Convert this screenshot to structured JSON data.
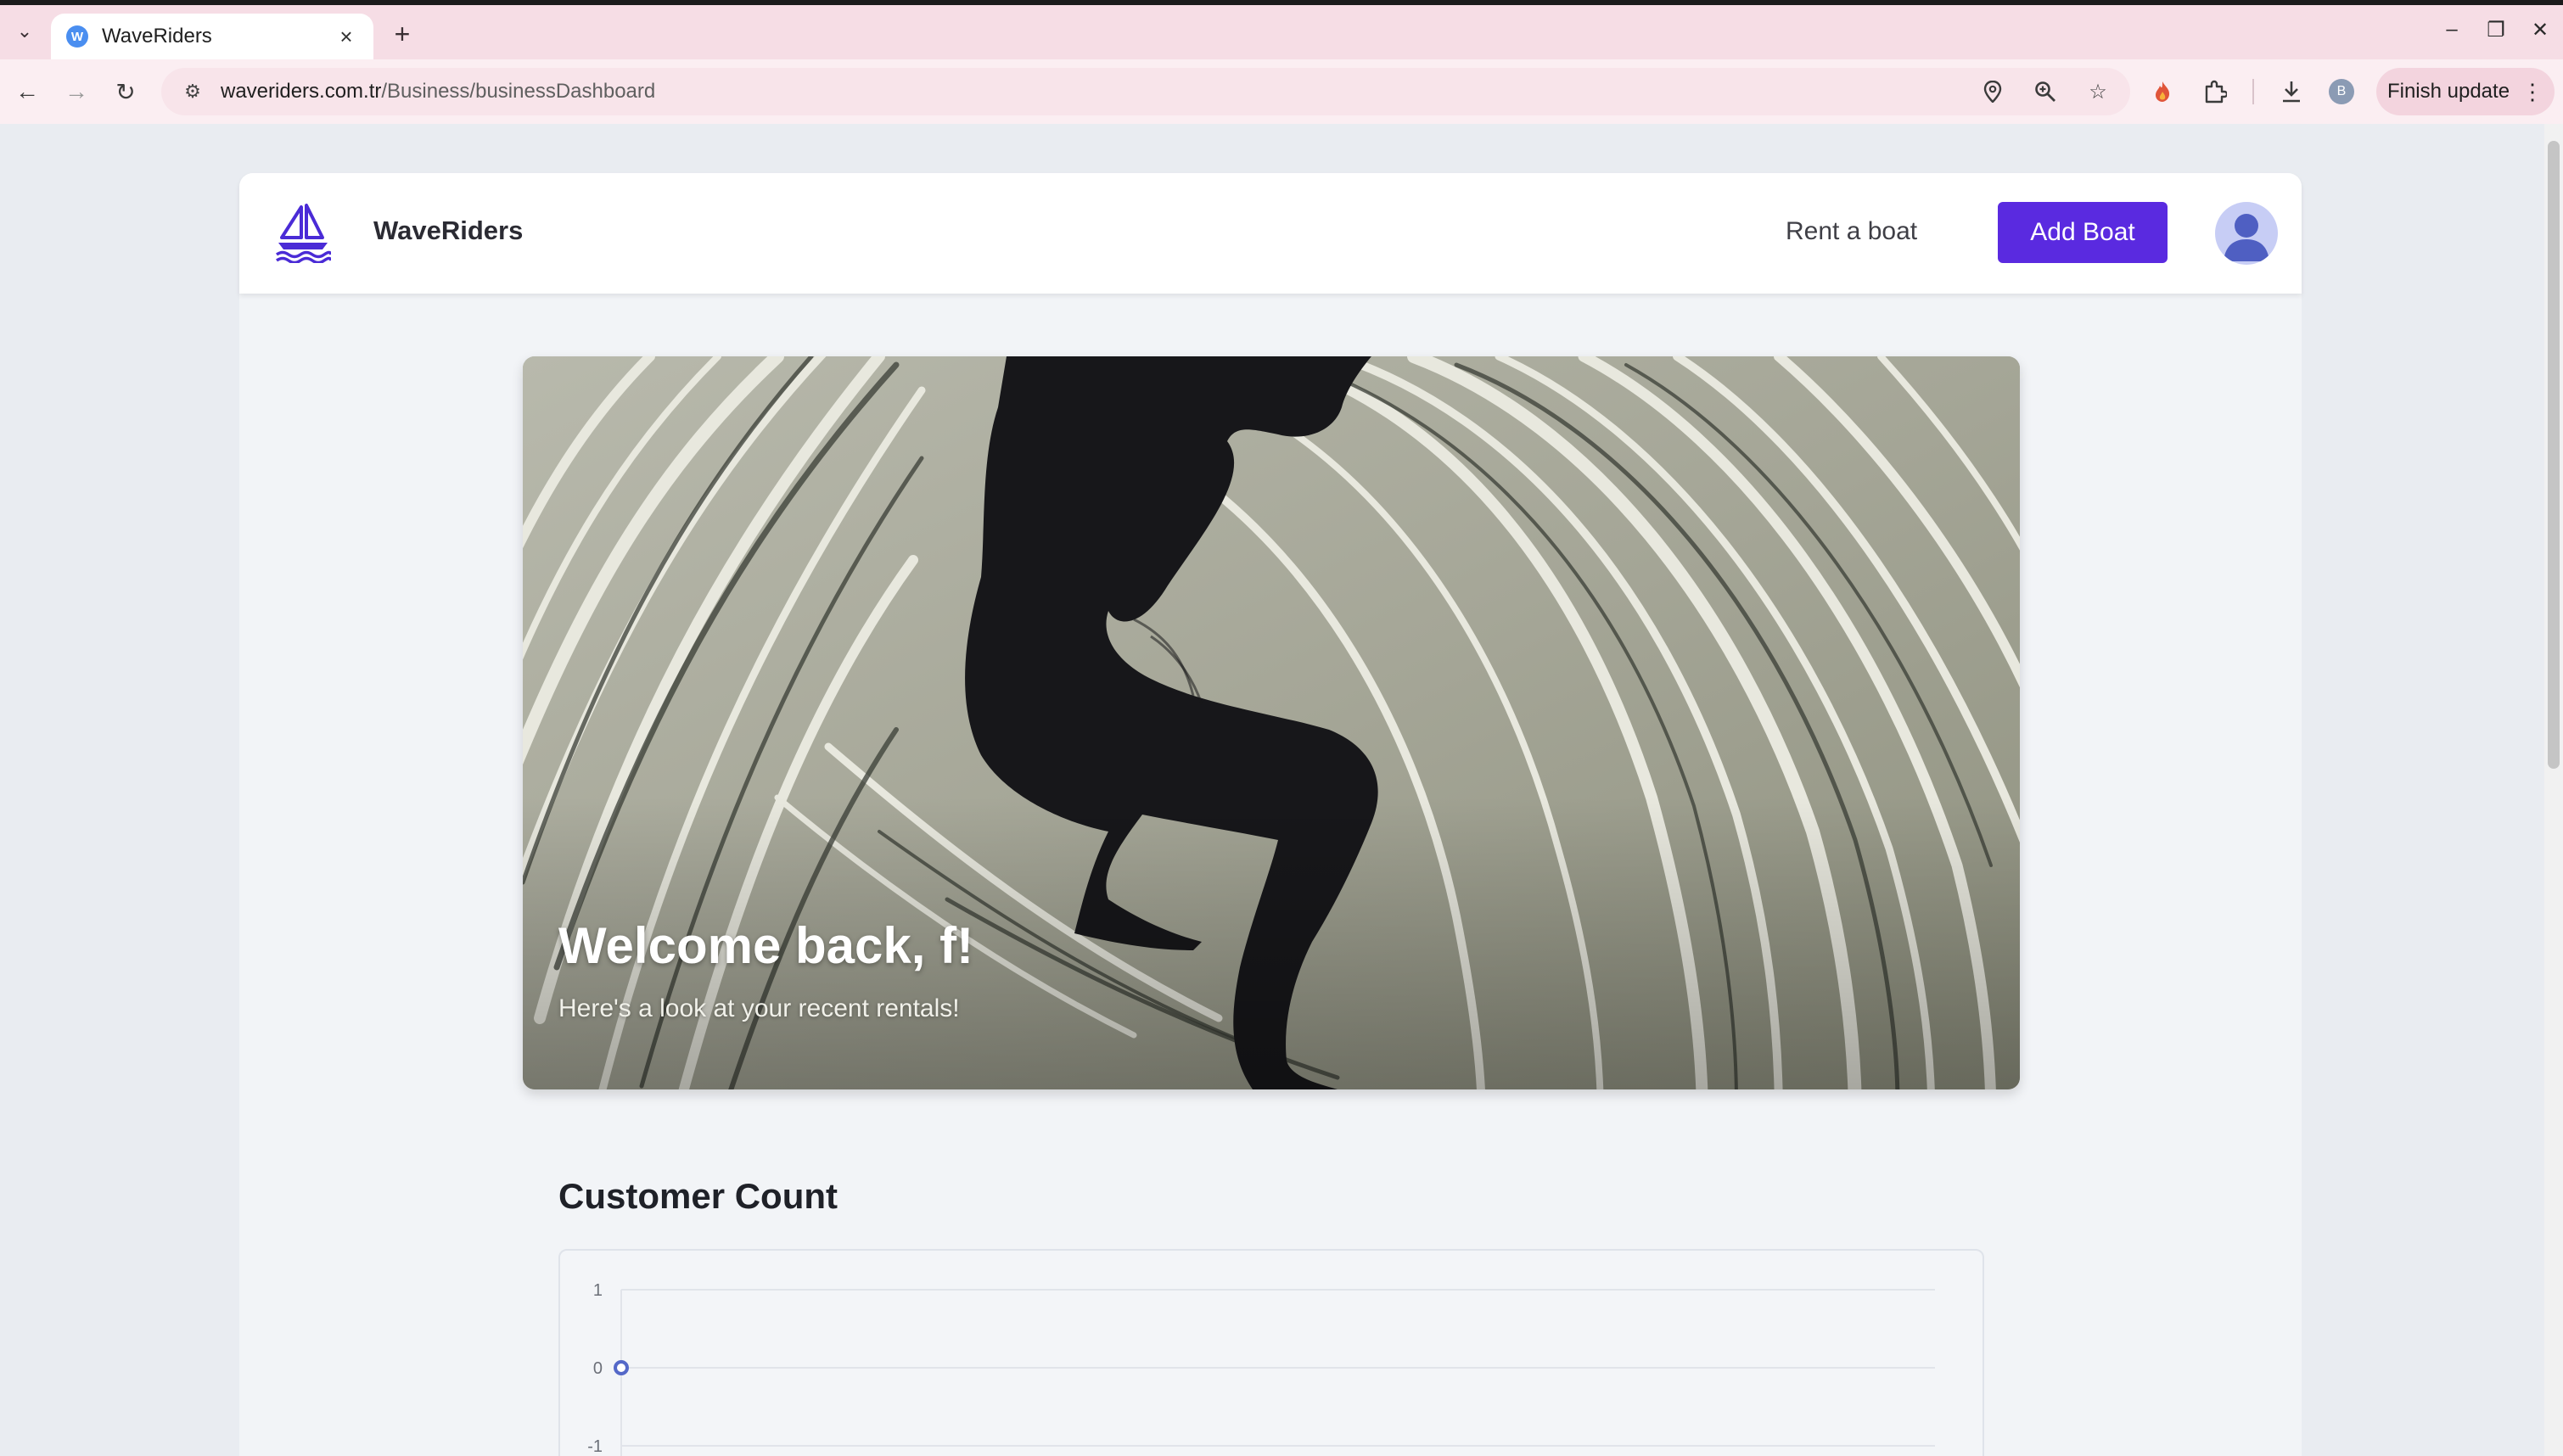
{
  "browser": {
    "tab_title": "WaveRiders",
    "tab_favicon_letter": "W",
    "url_domain": "waveriders.com.tr",
    "url_path": "/Business/businessDashboard",
    "finish_update_label": "Finish update",
    "profile_initial": "B",
    "icons": [
      "tab-list-icon",
      "close-icon",
      "plus-icon",
      "back-icon",
      "forward-icon",
      "reload-icon",
      "site-info-icon",
      "location-icon",
      "zoom-icon",
      "star-icon",
      "extension-icon",
      "puzzle-icon",
      "download-icon",
      "kebab-icon",
      "minimize-icon",
      "restore-icon",
      "window-close-icon"
    ]
  },
  "header": {
    "brand_name": "WaveRiders",
    "rent_link": "Rent a boat",
    "add_boat_label": "Add Boat"
  },
  "hero": {
    "title": "Welcome back, f!",
    "subtitle": "Here's a look at your recent rentals!"
  },
  "customer_count": {
    "title": "Customer Count"
  },
  "chart_data": {
    "type": "line",
    "title": "",
    "x": [
      0
    ],
    "series": [
      {
        "values": [
          0
        ]
      }
    ],
    "yticks": [
      "1",
      "0",
      "-1"
    ],
    "ylim": [
      -1,
      1
    ],
    "grid": true,
    "accent": "#5468c8"
  },
  "colors": {
    "accent": "#5a2ae0",
    "tabstrip": "#f6dde5"
  }
}
